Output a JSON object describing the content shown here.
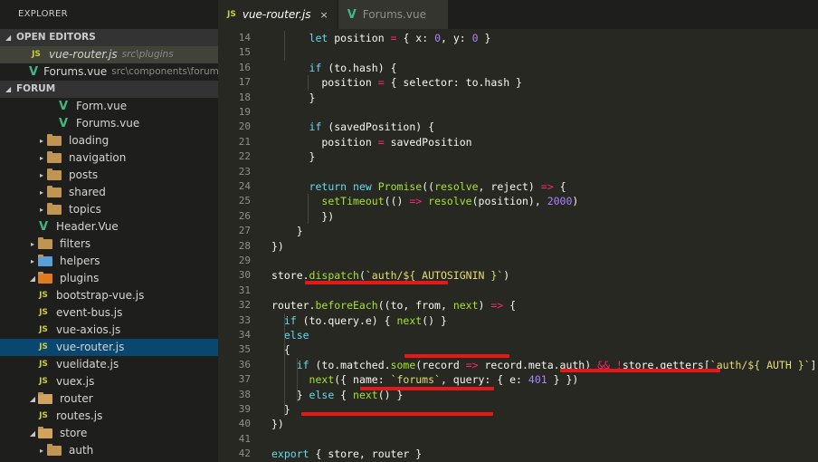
{
  "sidebar": {
    "title": "EXPLORER",
    "open_editors": {
      "label": "OPEN EDITORS",
      "items": [
        {
          "icon": "JS",
          "name": "vue-router.js",
          "desc": "src\\plugins"
        },
        {
          "icon": "V",
          "name": "Forums.vue",
          "desc": "src\\components\\forums"
        }
      ]
    },
    "project": {
      "label": "FORUM",
      "tree": [
        {
          "name": "Form.vue",
          "type": "vue"
        },
        {
          "name": "Forums.vue",
          "type": "vue"
        },
        {
          "name": "loading",
          "type": "folder"
        },
        {
          "name": "navigation",
          "type": "folder"
        },
        {
          "name": "posts",
          "type": "folder"
        },
        {
          "name": "shared",
          "type": "folder"
        },
        {
          "name": "topics",
          "type": "folder"
        },
        {
          "name": "Header.Vue",
          "type": "vue"
        },
        {
          "name": "filters",
          "type": "folder"
        },
        {
          "name": "helpers",
          "type": "folder"
        },
        {
          "name": "plugins",
          "type": "folder-open"
        },
        {
          "name": "bootstrap-vue.js",
          "type": "js"
        },
        {
          "name": "event-bus.js",
          "type": "js"
        },
        {
          "name": "vue-axios.js",
          "type": "js"
        },
        {
          "name": "vue-router.js",
          "type": "js"
        },
        {
          "name": "vuelidate.js",
          "type": "js"
        },
        {
          "name": "vuex.js",
          "type": "js"
        },
        {
          "name": "router",
          "type": "folder-open"
        },
        {
          "name": "routes.js",
          "type": "js"
        },
        {
          "name": "store",
          "type": "folder-open"
        },
        {
          "name": "auth",
          "type": "folder"
        }
      ]
    }
  },
  "tabs": [
    {
      "icon": "JS",
      "label": "vue-router.js",
      "close": "×"
    },
    {
      "icon": "V",
      "label": "Forums.vue",
      "close": ""
    }
  ],
  "editor": {
    "line_numbers": [
      "14",
      "15",
      "16",
      "17",
      "18",
      "19",
      "20",
      "21",
      "22",
      "23",
      "24",
      "25",
      "26",
      "27",
      "28",
      "29",
      "30",
      "31",
      "32",
      "33",
      "34",
      "35",
      "36",
      "37",
      "38",
      "39",
      "40",
      "41",
      "42"
    ],
    "lines": [
      "      let position = { x: 0, y: 0 }",
      "",
      "      if (to.hash) {",
      "        position = { selector: to.hash }",
      "      }",
      "",
      "      if (savedPosition) {",
      "        position = savedPosition",
      "      }",
      "",
      "      return new Promise((resolve, reject) => {",
      "        setTimeout(() => resolve(position), 2000)",
      "        })",
      "    }",
      "})",
      "",
      "store.dispatch(`auth/${ AUTOSIGNIN }`)",
      "",
      "router.beforeEach((to, from, next) => {",
      "  if (to.query.e) { next() }",
      "  else",
      "  {",
      "    if (to.matched.some(record => record.meta.auth) && !store.getters[`auth/${ AUTH }`]) {",
      "      next({ name: `forums`, query: { e: 401 } })",
      "    } else { next() }",
      "  }",
      "})",
      "",
      "export { store, router }"
    ]
  },
  "colors": {
    "keyword": "#66d9ef",
    "string": "#e6db74",
    "number": "#ae81ff",
    "operator": "#f92672",
    "plain": "#f8f8f2",
    "default": "#a6e22e",
    "annotation": "#e51919"
  }
}
